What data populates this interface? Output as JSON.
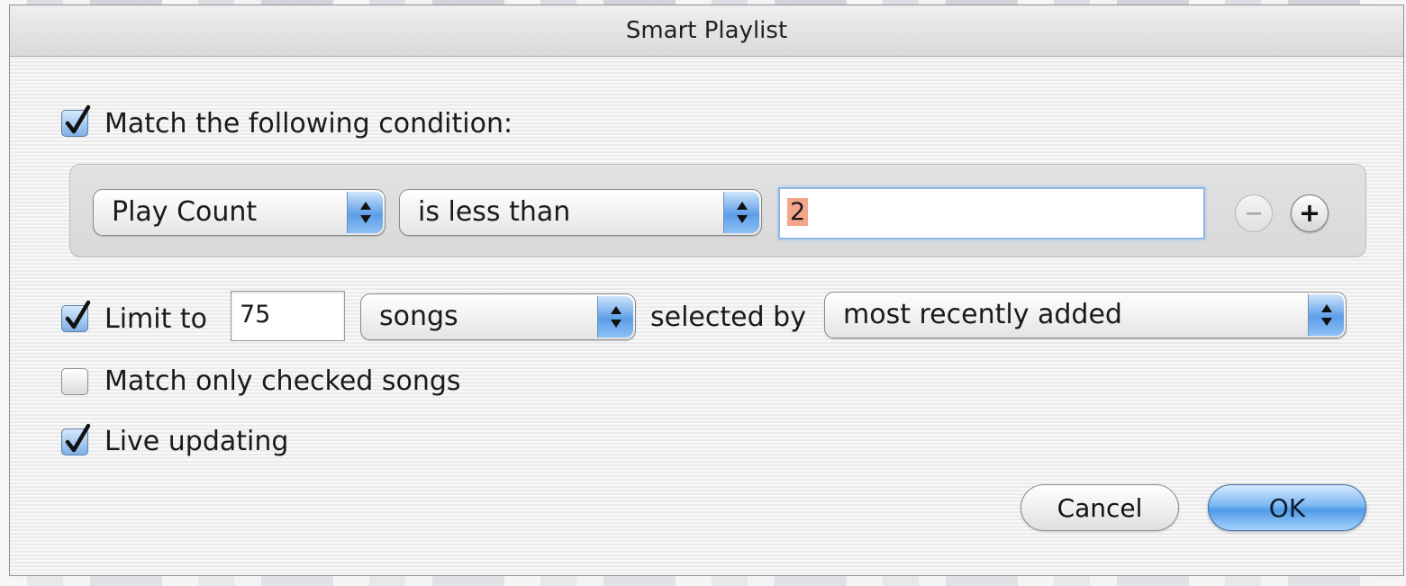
{
  "window": {
    "title": "Smart Playlist"
  },
  "match_condition": {
    "checked": true,
    "label": "Match the following condition:"
  },
  "rule": {
    "field": "Play Count",
    "operator": "is less than",
    "value": "2",
    "remove_icon": "minus-circle-icon",
    "add_icon": "plus-circle-icon"
  },
  "limit": {
    "checked": true,
    "label": "Limit to",
    "value": "75",
    "unit": "songs",
    "selected_by_label": "selected by",
    "selected_by": "most recently added"
  },
  "match_checked": {
    "checked": false,
    "label": "Match only checked songs"
  },
  "live_updating": {
    "checked": true,
    "label": "Live updating"
  },
  "buttons": {
    "cancel": "Cancel",
    "ok": "OK"
  },
  "colors": {
    "accent": "#5d9ee8",
    "selection": "#f5a58a",
    "default_button": "#4f9ae8"
  }
}
